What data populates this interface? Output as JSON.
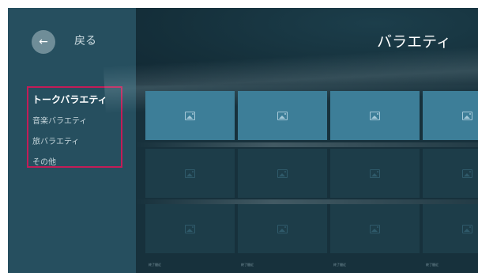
{
  "back": {
    "label": "戻る",
    "icon": "arrow-left-icon"
  },
  "page": {
    "title": "バラエティ"
  },
  "categories": [
    {
      "label": "トークバラエティ",
      "selected": true
    },
    {
      "label": "音楽バラエティ",
      "selected": false
    },
    {
      "label": "旅バラエティ",
      "selected": false
    },
    {
      "label": "その他",
      "selected": false
    }
  ],
  "grid": {
    "rows": 3,
    "columns": 4,
    "focused_row": 0,
    "tile_icon": "image-placeholder-icon",
    "captions": [
      "終了間近",
      "終了間近",
      "終了間近",
      "終了間近"
    ]
  },
  "colors": {
    "sidebar": "#264f5f",
    "background": "#17313c",
    "focused_tile": "#3d7e98",
    "tile": "#1d3d49",
    "selection_border": "#c21c57"
  }
}
